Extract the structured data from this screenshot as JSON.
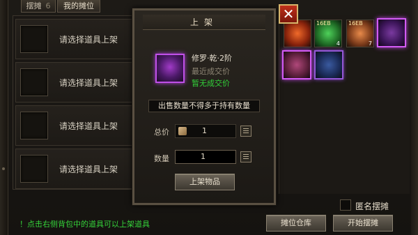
{
  "tabs": [
    {
      "label": "摆摊",
      "num": "6"
    },
    {
      "label": "我的摊位"
    }
  ],
  "slots": [
    {
      "label": "请选择道具上架"
    },
    {
      "label": "请选择道具上架"
    },
    {
      "label": "请选择道具上架"
    },
    {
      "label": "请选择道具上架"
    }
  ],
  "dialog": {
    "title": "上架",
    "item_name": "修罗·乾·2阶",
    "recent_label": "最近成交价",
    "recent_value": "暂无成交价",
    "notice": "出售数量不得多于持有数量",
    "total_label": "总价",
    "total_value": "1",
    "qty_label": "数量",
    "qty_value": "1",
    "list_button": "上架物品"
  },
  "inventory": [
    {
      "type": "orb-red",
      "tag": "",
      "count": ""
    },
    {
      "type": "orb-green",
      "tag": "16EB",
      "count": "4"
    },
    {
      "type": "orb-orange",
      "tag": "16EB",
      "count": "7"
    },
    {
      "type": "gear-purple",
      "tag": "",
      "count": ""
    },
    {
      "type": "gear-red",
      "tag": "",
      "count": ""
    },
    {
      "type": "gear-blue",
      "tag": "",
      "count": ""
    }
  ],
  "anonymous_label": "匿名摆摊",
  "warehouse_button": "摊位仓库",
  "start_button": "开始摆摊",
  "hint": "！点击右侧背包中的道具可以上架道具",
  "colors": {
    "hint_green": "#35d13a",
    "price_green": "#32d23a",
    "rare_purple": "#c050e8"
  }
}
